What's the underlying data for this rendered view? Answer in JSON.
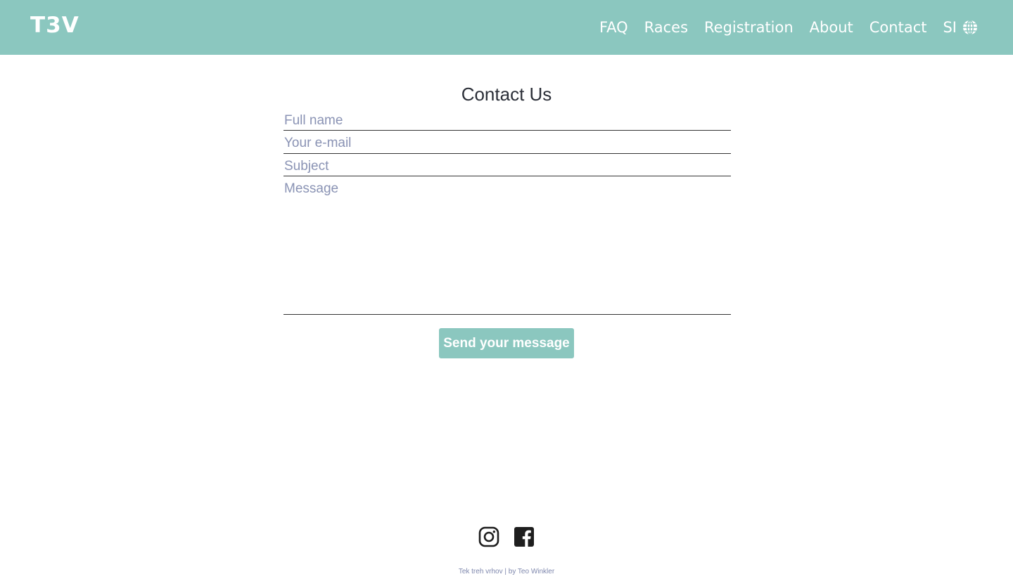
{
  "colors": {
    "accent": "#8bc7bf",
    "nav_text": "#ffffff",
    "title_text": "#2b2f38",
    "placeholder_text": "#8a93b4",
    "footer_text": "#7e87ad"
  },
  "header": {
    "logo": "T3V",
    "nav": [
      {
        "label": "FAQ"
      },
      {
        "label": "Races"
      },
      {
        "label": "Registration"
      },
      {
        "label": "About"
      },
      {
        "label": "Contact"
      }
    ],
    "language": {
      "label": "SI",
      "icon": "globe-icon"
    }
  },
  "page": {
    "title": "Contact Us"
  },
  "form": {
    "full_name": {
      "placeholder": "Full name",
      "value": ""
    },
    "email": {
      "placeholder": "Your e-mail",
      "value": ""
    },
    "subject": {
      "placeholder": "Subject",
      "value": ""
    },
    "message": {
      "placeholder": "Message",
      "value": ""
    },
    "submit_label": "Send your message"
  },
  "footer": {
    "social": [
      {
        "icon": "instagram-icon"
      },
      {
        "icon": "facebook-icon"
      }
    ],
    "credit": "Tek treh vrhov | by Teo Winkler"
  }
}
